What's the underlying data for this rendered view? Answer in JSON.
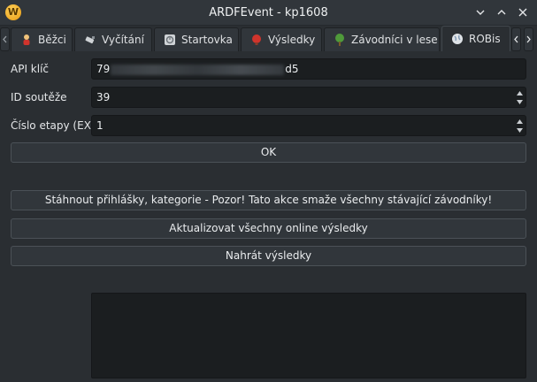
{
  "window": {
    "title": "ARDFEvent - kp1608",
    "app_icon_letter": "W"
  },
  "tabs": [
    {
      "label": "Běžci",
      "icon": "runner-icon",
      "active": false
    },
    {
      "label": "Vyčítání",
      "icon": "reader-icon",
      "active": false
    },
    {
      "label": "Startovka",
      "icon": "start-list-icon",
      "active": false
    },
    {
      "label": "Výsledky",
      "icon": "results-icon",
      "active": false
    },
    {
      "label": "Závodníci v lese",
      "icon": "forest-icon",
      "active": false
    },
    {
      "label": "ROBis",
      "icon": "globe-icon",
      "active": true
    }
  ],
  "form": {
    "api_key_label": "API klíč",
    "api_key_prefix": "79",
    "api_key_suffix": "d5",
    "competition_id_label": "ID soutěže",
    "competition_id_value": "39",
    "stage_label": "Číslo etapy (EX)",
    "stage_value": "1",
    "ok_label": "OK"
  },
  "actions": {
    "download_label": "Stáhnout přihlášky, kategorie - Pozor! Tato akce smaže všechny stávající závodníky!",
    "update_label": "Aktualizovat všechny online výsledky",
    "upload_label": "Nahrát výsledky"
  },
  "colors": {
    "background": "#2a2e32",
    "field": "#1b1e20",
    "button": "#31363b",
    "accent": "#e89b12"
  }
}
